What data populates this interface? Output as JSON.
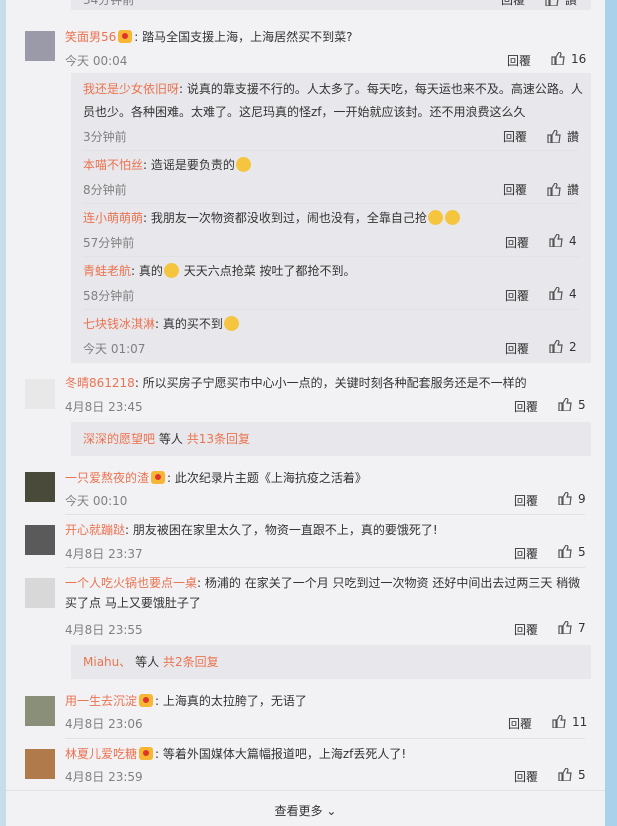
{
  "labels": {
    "reply": "回覆",
    "like": "讚"
  },
  "top": {
    "time": "34分钟前"
  },
  "c1": {
    "user": "笑面男56",
    "text": ": 踏马全国支援上海，上海居然买不到菜?",
    "time": "今天 00:04",
    "likes": "16"
  },
  "r1": {
    "user": "我还是少女依旧呀",
    "text": "说真的靠支援不行的。人太多了。每天吃，每天运也来不及。高速公路。人员也少。各种困难。太难了。这尼玛真的怪zf，一开始就应该封。还不用浪费这么久",
    "time": "3分钟前"
  },
  "r2": {
    "user": "本喵不怕丝",
    "text": "造谣是要负责的",
    "time": "8分钟前"
  },
  "r3": {
    "user": "连小萌萌萌",
    "text": "我朋友一次物资都没收到过，闹也没有，全靠自己抢",
    "time": "57分钟前",
    "likes": "4"
  },
  "r4": {
    "user": "青蛙老航",
    "text_a": "真的",
    "text_b": " 天天六点抢菜 按吐了都抢不到。",
    "time": "58分钟前",
    "likes": "4"
  },
  "r5": {
    "user": "七块钱冰淇淋",
    "text": "真的买不到",
    "time": "今天 01:07",
    "likes": "2"
  },
  "c2": {
    "user": "冬晴861218",
    "text": "所以买房子宁愿买市中心小一点的，关键时刻各种配套服务还是不一样的",
    "time": "4月8日 23:45",
    "likes": "5",
    "more_user": "深深的愿望吧",
    "more_mid": "等人",
    "more_count": "共13条回复"
  },
  "c3": {
    "user": "一只爱熬夜的渣",
    "text": "此次纪录片主题《上海抗疫之活着》",
    "time": "今天 00:10",
    "likes": "9"
  },
  "c4": {
    "user": "开心就蹦跶",
    "text": "朋友被困在家里太久了，物资一直跟不上，真的要饿死了!",
    "time": "4月8日 23:37",
    "likes": "5"
  },
  "c5": {
    "user": "一个人吃火锅也要点一桌",
    "text": "杨浦的 在家关了一个月 只吃到过一次物资 还好中间出去过两三天 稍微买了点 马上又要饿肚子了",
    "time": "4月8日 23:55",
    "likes": "7",
    "more_user": "Miahu、",
    "more_mid": "等人",
    "more_count": "共2条回复"
  },
  "c6": {
    "user": "用一生去沉淀",
    "text": "上海真的太拉胯了，无语了",
    "time": "4月8日 23:06",
    "likes": "11"
  },
  "c7": {
    "user": "林夏儿爱吃糖",
    "text": "等着外国媒体大篇幅报道吧，上海zf丢死人了!",
    "time": "4月8日 23:59",
    "likes": "5"
  },
  "footer": {
    "view_more": "查看更多"
  },
  "colors": {
    "username": "#eb7350",
    "background": "#f2f2f5",
    "reply_bg": "#e8e8ec",
    "page_edge": "#aad1ec"
  }
}
